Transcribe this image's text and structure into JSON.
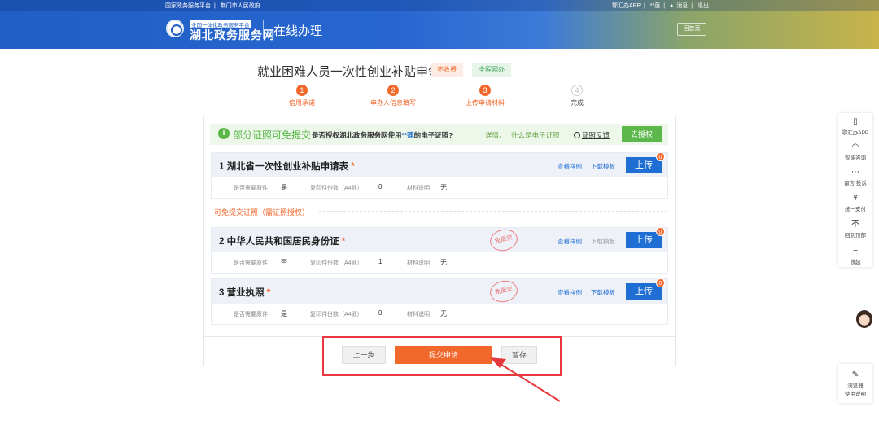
{
  "header": {
    "top_links_left": [
      "国家政务服务平台",
      "荆门市人民政府"
    ],
    "top_links_right": [
      "鄂汇办APP",
      "**莲",
      "消息",
      "退出"
    ],
    "logo_sub": "全国一体化政务服务平台",
    "logo_main": "湖北政务服务网",
    "section": "在线办理",
    "home_label": "回首页"
  },
  "title": {
    "text": "就业困难人员一次性创业补贴申领",
    "tag_fee": "不收费",
    "tag_online": "全程网办"
  },
  "steps": [
    {
      "num": "1",
      "label": "信用承诺"
    },
    {
      "num": "2",
      "label": "申办人信息填写"
    },
    {
      "num": "3",
      "label": "上传申请材料"
    },
    {
      "num": "4",
      "label": "完成"
    }
  ],
  "notice": {
    "icon": "info-icon",
    "title": "部分证照可免提交",
    "question_pre": "是否授权湖北政务服务网使用",
    "question_name": "**莲",
    "question_post": "的电子证照?",
    "link_detail": "详情、",
    "link_what": "什么是电子证照",
    "feedback": "证照反馈",
    "authorize": "去授权"
  },
  "exempt_label": "可免提交证照（需证照授权）",
  "materials": [
    {
      "title": "1  湖北省一次性创业补贴申请表",
      "req": "*",
      "view_sample": "查看样例",
      "download": "下载模板",
      "upload": "上传",
      "count": "0",
      "original_label": "是否需要原件",
      "original_value": "是",
      "copies_label": "复印件份数（A4纸）",
      "copies_value": "0",
      "note_label": "材料说明",
      "note_value": "无",
      "stamp": ""
    },
    {
      "title": "2  中华人民共和国居民身份证",
      "req": "*",
      "view_sample": "查看样例",
      "download": "下载模板",
      "upload": "上传",
      "count": "0",
      "original_label": "是否需要原件",
      "original_value": "否",
      "copies_label": "复印件份数（A4纸）",
      "copies_value": "1",
      "note_label": "材料说明",
      "note_value": "无",
      "stamp": "免提交"
    },
    {
      "title": "3  营业执照",
      "req": "*",
      "view_sample": "查看样例",
      "download": "下载模板",
      "upload": "上传",
      "count": "0",
      "original_label": "是否需要原件",
      "original_value": "是",
      "copies_label": "复印件份数（A4纸）",
      "copies_value": "0",
      "note_label": "材料说明",
      "note_value": "无",
      "stamp": "免提交"
    }
  ],
  "actions": {
    "prev": "上一步",
    "submit": "提交申请",
    "save": "暂存"
  },
  "sidebar": [
    {
      "icon": "phone-icon",
      "glyph": "▯",
      "label": "鄂汇办APP"
    },
    {
      "icon": "headset-icon",
      "glyph": "◠",
      "label": "智能咨询"
    },
    {
      "icon": "message-icon",
      "glyph": "⋯",
      "label": "留言 投诉"
    },
    {
      "icon": "yuan-icon",
      "glyph": "¥",
      "label": "统一支付"
    },
    {
      "icon": "back-to-top-icon",
      "glyph": "不",
      "label": "回到顶部"
    },
    {
      "icon": "collapse-icon",
      "glyph": "−",
      "label": "收起"
    }
  ],
  "browser_help": {
    "icon": "leaf-icon",
    "glyph": "✎",
    "label_line1": "浏览器",
    "label_line2": "使用说明"
  },
  "colors": {
    "brand_blue": "#1f6ed4",
    "accent_orange": "#f2672a",
    "success_green": "#5bb74a",
    "highlight_red": "#e8383d"
  }
}
